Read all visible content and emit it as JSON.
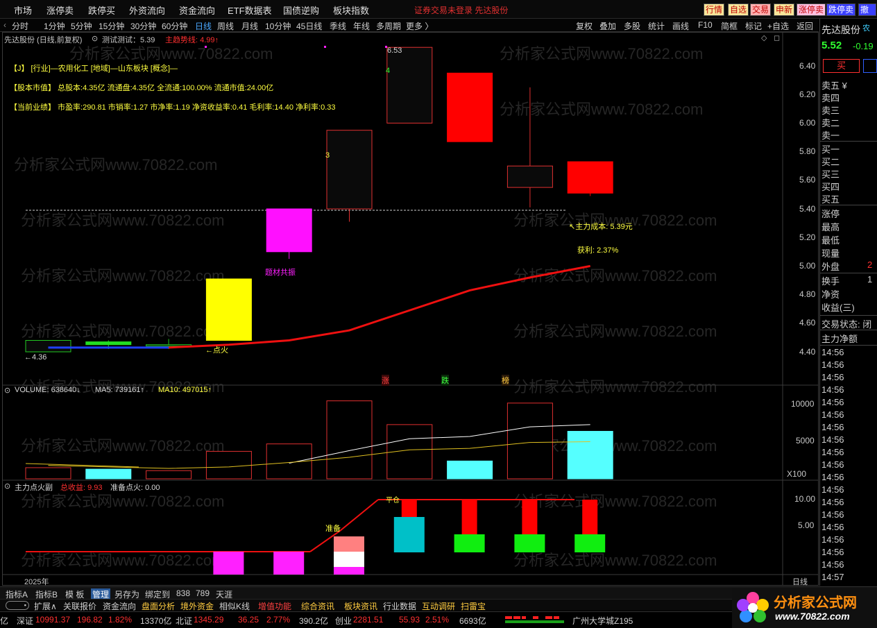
{
  "top_menu": {
    "items": [
      "市场",
      "涨停卖",
      "跌停买",
      "外资流向",
      "资金流向",
      "ETF数据表",
      "国债逆购",
      "板块指数"
    ],
    "status": "证券交易未登录  先达股份",
    "right_buttons": [
      "行情",
      "自选",
      "交易",
      "申新",
      "涨停卖",
      "跌停卖",
      "撤单"
    ]
  },
  "period_toolbar": {
    "periods": [
      "分时",
      "1分钟",
      "5分钟",
      "15分钟",
      "30分钟",
      "60分钟",
      "日线",
      "周线",
      "月线",
      "10分钟",
      "45日线",
      "季线",
      "年线",
      "多周期",
      "更多 〉"
    ],
    "tools": [
      "复权",
      "叠加",
      "多股",
      "统计",
      "画线",
      "F10",
      "简框",
      "标记",
      "+自选",
      "返回"
    ]
  },
  "chart_header": {
    "stock": "先达股份 (日线,前复权)",
    "indicator": "测试测试：5.39",
    "trend": "主趋势线: 4.99↑"
  },
  "info_lines": {
    "industry": "【J】 [行业]—农用化工 [地域]—山东板块 [概念]—",
    "share_capital": "【股本市值】 总股本:4.35亿 流通盘:4.35亿 全流通:100.00% 流通市值:24.00亿",
    "performance": "【当前业绩】 市盈率:290.81 市销率:1.27 市净率:1.19 净资收益率:0.41 毛利率:14.40 净利率:0.33"
  },
  "annotations": {
    "high": "6.53",
    "low": "←4.36",
    "fire": "←点火",
    "theme": "题材共振",
    "count3": "3",
    "count4": "4",
    "main_cost": "↖主力成本: 5.39元",
    "profit": "获利: 2.37%",
    "zhang": "涨",
    "die": "跌",
    "bang": "榜",
    "prepare": "准备",
    "ping": "平仓"
  },
  "price_axis": [
    "6.40",
    "6.20",
    "6.00",
    "5.80",
    "5.60",
    "5.40",
    "5.20",
    "5.00",
    "4.80",
    "4.60",
    "4.40"
  ],
  "volume_header": {
    "label": "VOLUME: 638640↓",
    "ma5": "MA5: 739161↑",
    "ma10": "MA10: 497015↑"
  },
  "volume_axis": [
    "10000",
    "5000",
    "X100"
  ],
  "indicator_header": {
    "name": "主力点火副",
    "total": "总收益: 9.93",
    "ready": "准备点火: 0.00"
  },
  "indicator_axis": [
    "10.00",
    "5.00"
  ],
  "date_label": "2025年",
  "period_label": "日线",
  "side_panel": {
    "name": "先达股份",
    "suffix": "农",
    "price": "5.52",
    "change": "-0.19",
    "buy": "买",
    "asks": [
      "卖五 ¥",
      "卖四",
      "卖三",
      "卖二",
      "卖一"
    ],
    "bids": [
      "买一",
      "买二",
      "买三",
      "买四",
      "买五"
    ],
    "stats": [
      "涨停",
      "最高",
      "最低",
      "现量",
      "外盘",
      "换手",
      "净资",
      "收益(三)"
    ],
    "stat_values": {
      "waipan": "2",
      "huanshou": "1"
    },
    "trade_status": "交易状态: 闭",
    "main_flow": "主力净额",
    "ticks": [
      "14:56",
      "14:56",
      "14:56",
      "14:56",
      "14:56",
      "14:56",
      "14:56",
      "14:56",
      "14:56",
      "14:56",
      "14:56",
      "14:56",
      "14:56",
      "14:56",
      "14:56",
      "14:56",
      "14:56",
      "14:56",
      "14:57",
      "14:56"
    ]
  },
  "bottom_tabs": [
    "指标A",
    "指标B",
    "模 板",
    "管理",
    "另存为",
    "绑定到",
    "838",
    "789",
    "天涯"
  ],
  "bottom_bar2": [
    "扩展∧",
    "关联报价",
    "资金流向",
    "盘面分析",
    "境外资金",
    "相似K线",
    "增值功能",
    "综合资讯",
    "板块资讯",
    "行业数据",
    "互动调研",
    "扫雷宝"
  ],
  "ticker": {
    "unit": "亿",
    "sz_name": "深证",
    "sz_value": "10991.37",
    "sz_change": "196.82",
    "sz_pct": "1.82%",
    "sz_amount": "13370亿",
    "bz_name": "北证",
    "bz_value": "1345.29",
    "bz_change": "36.25",
    "bz_pct": "2.77%",
    "bz_amount": "390.2亿",
    "cy_name": "创业",
    "cy_value": "2281.51",
    "cy_change": "55.93",
    "cy_pct": "2.51%",
    "cy_amount": "6693亿",
    "location": "广州大学城Z195"
  },
  "logo": {
    "title": "分析家公式网",
    "url": "www.70822.com"
  },
  "watermark": "分析家公式网www.70822.com",
  "chart_data": {
    "type": "candlestick",
    "candles": [
      {
        "open": 4.4,
        "close": 4.48,
        "high": 4.48,
        "low": 4.4
      },
      {
        "open": 4.47,
        "close": 4.45,
        "high": 4.48,
        "low": 4.42
      },
      {
        "open": 4.45,
        "close": 4.45,
        "high": 4.49,
        "low": 4.42
      },
      {
        "open": 4.48,
        "close": 4.91,
        "high": 4.91,
        "low": 4.48
      },
      {
        "open": 5.4,
        "close": 5.1,
        "high": 5.4,
        "low": 5.05
      },
      {
        "open": 5.4,
        "close": 5.95,
        "high": 5.95,
        "low": 5.31
      },
      {
        "open": 6.0,
        "close": 6.53,
        "high": 6.53,
        "low": 6.0
      },
      {
        "open": 6.35,
        "close": 5.87,
        "high": 6.35,
        "low": 5.87
      },
      {
        "open": 5.55,
        "close": 5.7,
        "high": 6.25,
        "low": 5.41
      },
      {
        "open": 5.73,
        "close": 5.51,
        "high": 5.73,
        "low": 5.49
      }
    ],
    "colors": [
      "#0a0a0a",
      "#22dd22",
      "#0a0a0a",
      "#ffff00",
      "#ff10ff",
      "#0a0a0a",
      "#0a0a0a",
      "#ff0000",
      "#0a0a0a",
      "#ff0000"
    ],
    "borders": [
      "#22cc22",
      "#22dd22",
      "#22cc22",
      "#ffff00",
      "#ff10ff",
      "#e03030",
      "#e03030",
      "#ff0000",
      "#e03030",
      "#ff0000"
    ],
    "trend_line": [
      4.43,
      4.43,
      4.43,
      4.45,
      4.48,
      4.55,
      4.69,
      4.83,
      4.92,
      5.0
    ],
    "main_cost": 5.39,
    "volume": [
      1500,
      1300,
      1100,
      3700,
      4700,
      10500,
      7300,
      2400,
      10200,
      6400
    ],
    "volume_colors": [
      "#000000",
      "#55ffff",
      "#000000",
      "#000000",
      "#000000",
      "#000000",
      "#000000",
      "#55ffff",
      "#000000",
      "#55ffff"
    ],
    "ma5": [
      null,
      null,
      null,
      null,
      2100,
      3800,
      5400,
      5700,
      7000,
      7300
    ],
    "ma10": [
      1800,
      1600,
      1400,
      1600,
      2200,
      2900,
      3900,
      4100,
      4900,
      5000
    ],
    "indicator": [
      {
        "magenta": 5.0,
        "red": 0,
        "green": 0,
        "cyan": 0
      },
      {
        "magenta": 5.0,
        "red": 0,
        "green": 0,
        "cyan": 0
      },
      {
        "magenta": 0,
        "red": 0,
        "green": 0,
        "cyan": 0
      },
      {
        "magenta": 0,
        "red": 0,
        "green": 0,
        "cyan": 0
      },
      {
        "magenta": 0,
        "red": 0,
        "green": 0,
        "cyan": 0
      },
      {
        "magenta": 0,
        "red": 0,
        "green": 0,
        "cyan": 0
      },
      {
        "magenta": 0,
        "red": 10.0,
        "green": 0,
        "cyan": 7.0
      },
      {
        "magenta": 0,
        "red": 10.0,
        "green": 3.3,
        "cyan": 0
      },
      {
        "magenta": 0,
        "red": 10.0,
        "green": 3.3,
        "cyan": 0
      },
      {
        "magenta": 0,
        "red": 10.0,
        "green": 3.3,
        "cyan": 0
      }
    ]
  }
}
